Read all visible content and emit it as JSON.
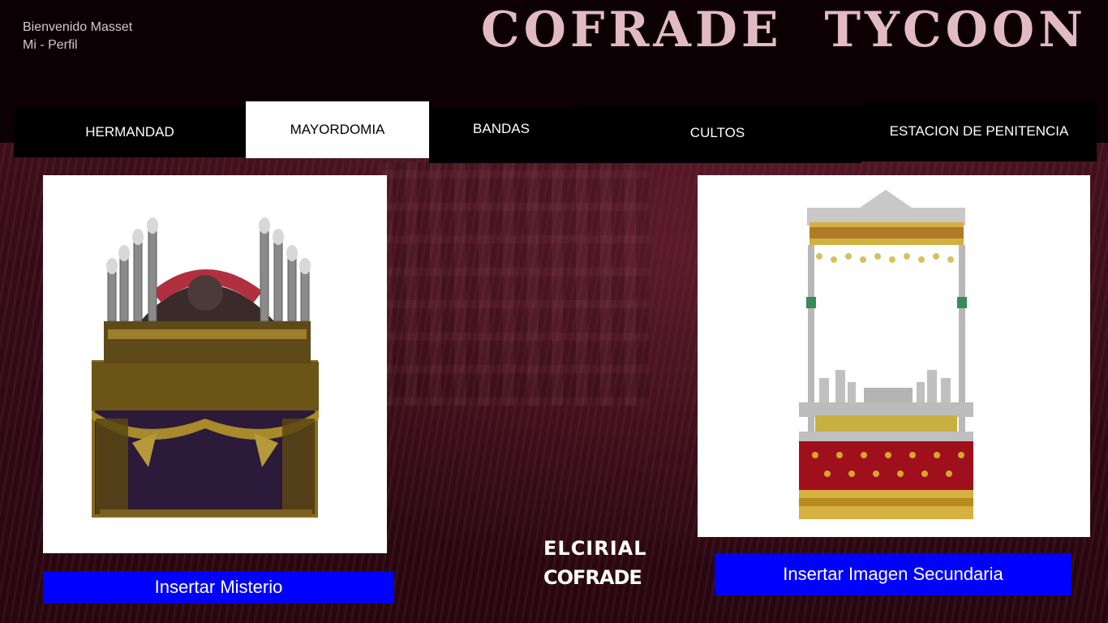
{
  "header": {
    "welcome": "Bienvenido Masset",
    "profile_link": "Mi - Perfil",
    "title": "COFRADE  TYCOON"
  },
  "nav": {
    "items": [
      {
        "label": "HERMANDAD"
      },
      {
        "label": "MAYORDOMIA"
      },
      {
        "label": "BANDAS"
      },
      {
        "label": "CULTOS"
      },
      {
        "label": "ESTACION DE PENITENCIA"
      }
    ],
    "active": "MAYORDOMIA"
  },
  "left_panel": {
    "image": "paso-misterio-image",
    "button_label": "Insertar Misterio"
  },
  "right_panel": {
    "image": "paso-palio-image",
    "button_label": "Insertar Imagen Secundaria"
  },
  "logo": {
    "line1": "ELCIRIAL",
    "line2": "COFRADE"
  },
  "colors": {
    "header_bg": "#0c0004",
    "title": "#e2bac6",
    "button_bg": "#0000ff",
    "page_bg": "#3a0a14"
  }
}
